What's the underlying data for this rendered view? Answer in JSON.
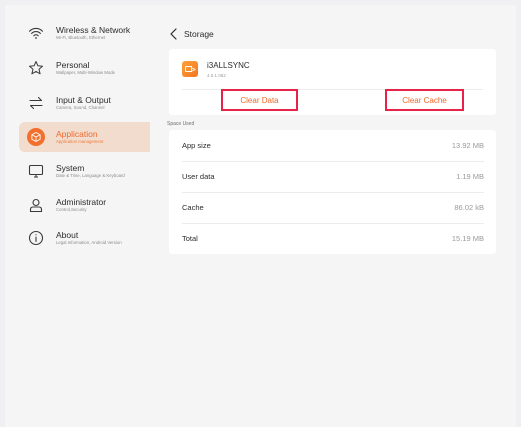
{
  "sidebar": {
    "items": [
      {
        "title": "Wireless & Network",
        "subtitle": "Wi-Fi, Bluetooth, Ethernet",
        "icon": "wifi-icon"
      },
      {
        "title": "Personal",
        "subtitle": "Wallpaper, Multi-Window Mode",
        "icon": "star-icon"
      },
      {
        "title": "Input & Output",
        "subtitle": "Camera, Sound, Channel",
        "icon": "swap-arrows-icon"
      },
      {
        "title": "Application",
        "subtitle": "Application management",
        "icon": "cube-icon",
        "active": true
      },
      {
        "title": "System",
        "subtitle": "Date & Time, Language & Keyboard",
        "icon": "monitor-icon"
      },
      {
        "title": "Administrator",
        "subtitle": "Control,Security",
        "icon": "user-icon"
      },
      {
        "title": "About",
        "subtitle": "Legal Information, Android Version",
        "icon": "info-icon"
      }
    ]
  },
  "header": {
    "title": "Storage",
    "back_icon": "chevron-left-icon"
  },
  "app": {
    "name": "i3ALLSYNC",
    "version": "4.0.1.062",
    "icon": "app-icon"
  },
  "actions": {
    "clear_data": "Clear Data",
    "clear_cache": "Clear Cache"
  },
  "usage": {
    "section_label": "Space Used",
    "rows": [
      {
        "label": "App size",
        "value": "13.92 MB"
      },
      {
        "label": "User data",
        "value": "1.19 MB"
      },
      {
        "label": "Cache",
        "value": "86.02 kB"
      },
      {
        "label": "Total",
        "value": "15.19 MB"
      }
    ]
  },
  "colors": {
    "accent": "#f06a2a",
    "active_bg": "#f1dccd",
    "highlight_border": "#e8234a",
    "background": "#f5f5f6",
    "card": "#ffffff"
  }
}
